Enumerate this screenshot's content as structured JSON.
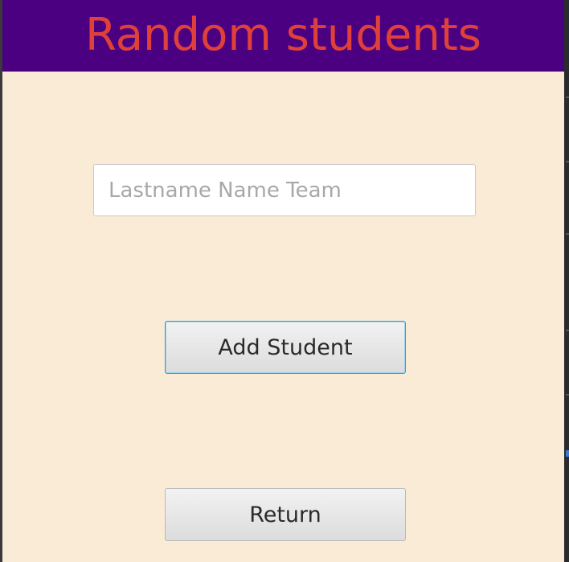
{
  "header": {
    "title": "Random students"
  },
  "form": {
    "student_input": {
      "value": "",
      "placeholder": "Lastname Name Team"
    },
    "add_button_label": "Add Student",
    "return_button_label": "Return"
  },
  "colors": {
    "header_background": "#4b0082",
    "title_text": "#e0403a",
    "window_background": "#faebd7",
    "focus_border": "#2f9fd8"
  }
}
